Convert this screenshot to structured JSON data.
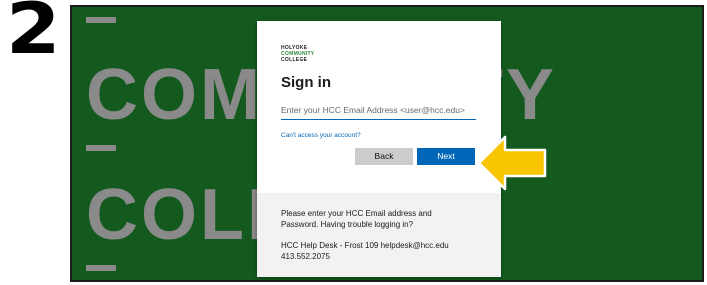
{
  "step": {
    "number": "2"
  },
  "background": {
    "word_top": "COMMUNITY",
    "word_bottom": "COLLEGE"
  },
  "logo": {
    "line1": "HOLYOKE",
    "line2": "COMMUNITY",
    "line3": "COLLEGE"
  },
  "signin": {
    "title": "Sign in",
    "email_placeholder": "Enter your HCC Email Address <user@hcc.edu>",
    "cant_access": "Can't access your account?",
    "back_label": "Back",
    "next_label": "Next"
  },
  "help": {
    "line1": "Please enter your HCC Email address and",
    "line2": "Password. Having trouble logging in?",
    "line3": "HCC Help Desk - Frost 109 helpdesk@hcc.edu",
    "line4": "413.552.2075"
  },
  "colors": {
    "accent": "#0067b8",
    "background_green": "#145a1f",
    "arrow_yellow": "#f7c600"
  },
  "icons": {
    "pointer": "arrow-left-icon"
  }
}
